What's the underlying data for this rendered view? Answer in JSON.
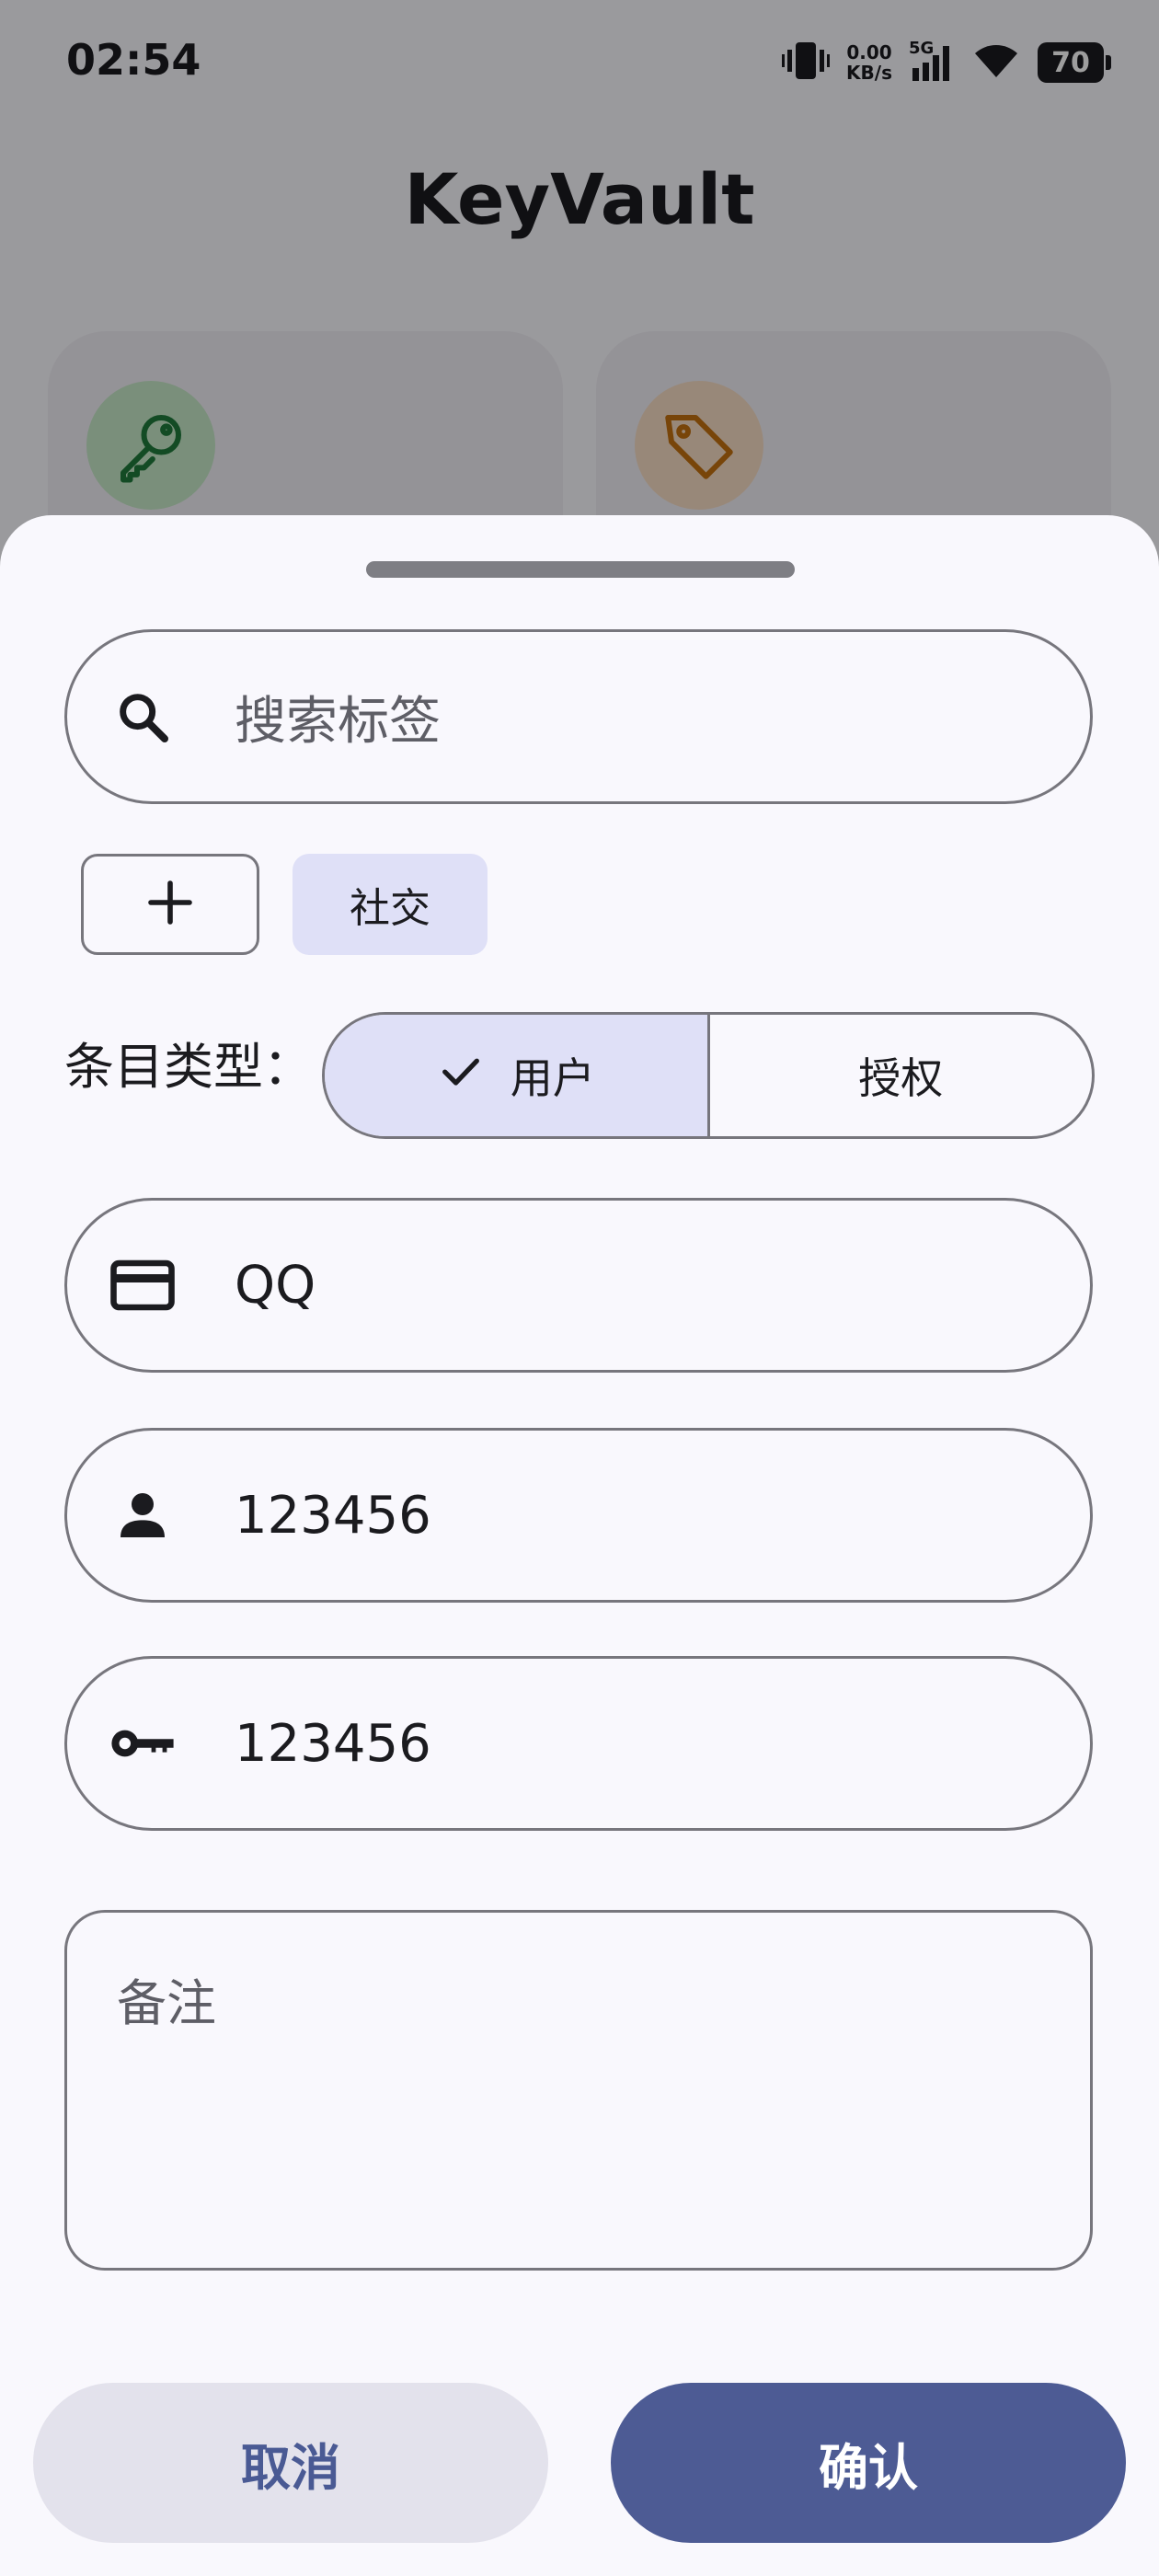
{
  "status_bar": {
    "time": "02:54",
    "net_speed_value": "0.00",
    "net_speed_unit": "KB/s",
    "network": "5G",
    "battery": "70"
  },
  "app": {
    "title": "KeyVault"
  },
  "colors": {
    "primary": "#4d5b94",
    "secondary_container": "#dfe0f7",
    "outline": "#77767d",
    "key_card_icon": "#1f7a3a",
    "tag_card_icon": "#c2700f"
  },
  "sheet": {
    "search": {
      "placeholder": "搜索标签",
      "icon": "search-icon"
    },
    "tags": {
      "add_icon": "plus-icon",
      "items": [
        "社交"
      ]
    },
    "entry_type": {
      "label": "条目类型：",
      "options": [
        "用户",
        "授权"
      ],
      "selected": "用户"
    },
    "fields": {
      "title": {
        "value": "QQ",
        "icon": "card-icon"
      },
      "username": {
        "value": "123456",
        "icon": "person-icon"
      },
      "password": {
        "value": "123456",
        "icon": "key-icon"
      }
    },
    "notes": {
      "placeholder": "备注"
    },
    "buttons": {
      "cancel": "取消",
      "confirm": "确认"
    }
  }
}
